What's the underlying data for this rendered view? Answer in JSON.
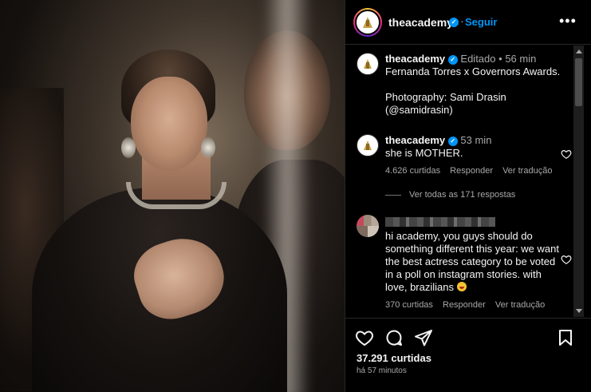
{
  "post": {
    "username": "theacademy",
    "follow_label": "Seguir",
    "more_label": "•••",
    "likes": "37.291 curtidas",
    "time_ago": "há 57 minutos"
  },
  "caption": {
    "username": "theacademy",
    "edited": "Editado",
    "separator": "•",
    "time": "56 min",
    "text": "Fernanda Torres x Governors Awards.\n\nPhotography: Sami Drasin\n(@samidrasin)"
  },
  "comments": [
    {
      "username": "theacademy",
      "time": "53 min",
      "text": "she is MOTHER.",
      "likes": "4.626 curtidas",
      "reply": "Responder",
      "translate": "Ver tradução"
    },
    {
      "username": "",
      "time": "",
      "text": "hi academy, you guys should do something different this year: we want the best actress category to be voted in a poll on instagram stories. with love, brazilians",
      "likes": "370 curtidas",
      "reply": "Responder",
      "translate": "Ver tradução"
    }
  ],
  "view_replies": "Ver todas as 171 respostas",
  "icons": {
    "like": "heart-icon",
    "comment": "comment-icon",
    "share": "send-icon",
    "save": "bookmark-icon",
    "verified": "verified-badge-icon"
  },
  "colors": {
    "accent": "#0095f6",
    "muted": "#a8a8a8",
    "background": "#000000"
  }
}
